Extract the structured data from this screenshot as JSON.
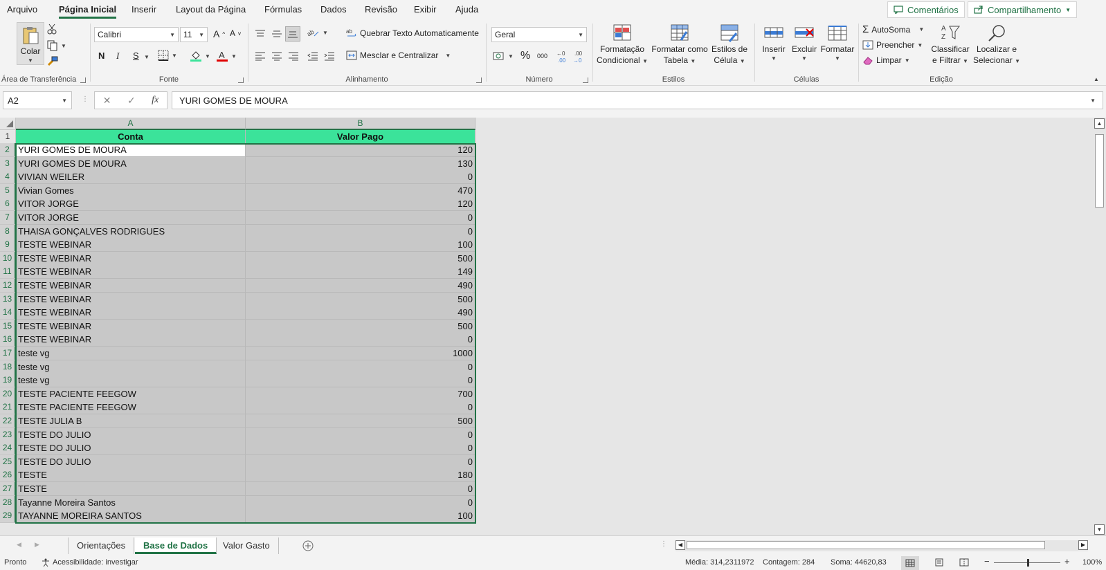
{
  "menu": {
    "tabs": [
      "Arquivo",
      "Página Inicial",
      "Inserir",
      "Layout da Página",
      "Fórmulas",
      "Dados",
      "Revisão",
      "Exibir",
      "Ajuda"
    ],
    "active_tab": "Página Inicial",
    "comments_label": "Comentários",
    "share_label": "Compartilhamento"
  },
  "ribbon": {
    "clipboard": {
      "label": "Área de Transferência",
      "paste_label": "Colar"
    },
    "font": {
      "label": "Fonte",
      "font_name": "Calibri",
      "font_size": "11",
      "bold": "N",
      "italic": "I",
      "underline": "S"
    },
    "alignment": {
      "label": "Alinhamento",
      "wrap_label": "Quebrar Texto Automaticamente",
      "merge_label": "Mesclar e Centralizar"
    },
    "number": {
      "label": "Número",
      "format": "Geral",
      "percent": "%",
      "thousands": "000"
    },
    "styles": {
      "label": "Estilos",
      "cond_format_line1": "Formatação",
      "cond_format_line2": "Condicional",
      "table_line1": "Formatar como",
      "table_line2": "Tabela",
      "cell_styles_line1": "Estilos de",
      "cell_styles_line2": "Célula"
    },
    "cells": {
      "label": "Células",
      "insert_label": "Inserir",
      "delete_label": "Excluir",
      "format_label": "Formatar"
    },
    "editing": {
      "label": "Edição",
      "autosum_label": "AutoSoma",
      "fill_label": "Preencher",
      "clear_label": "Limpar",
      "sort_line1": "Classificar",
      "sort_line2": "e Filtrar",
      "find_line1": "Localizar e",
      "find_line2": "Selecionar"
    }
  },
  "formula_bar": {
    "name_box": "A2",
    "fx_symbol": "fx",
    "value": "YURI GOMES DE MOURA"
  },
  "sheet": {
    "columns": [
      "A",
      "B"
    ],
    "header_row": {
      "row": "1",
      "a": "Conta",
      "b": "Valor Pago"
    },
    "rows": [
      {
        "row": "2",
        "a": "YURI GOMES DE MOURA",
        "b": "120"
      },
      {
        "row": "3",
        "a": "YURI GOMES DE MOURA",
        "b": "130"
      },
      {
        "row": "4",
        "a": "VIVIAN WEILER",
        "b": "0"
      },
      {
        "row": "5",
        "a": "Vivian Gomes",
        "b": "470"
      },
      {
        "row": "6",
        "a": "VITOR JORGE",
        "b": "120"
      },
      {
        "row": "7",
        "a": "VITOR JORGE",
        "b": "0"
      },
      {
        "row": "8",
        "a": "THAISA GONÇALVES RODRIGUES",
        "b": "0"
      },
      {
        "row": "9",
        "a": "TESTE WEBINAR",
        "b": "100"
      },
      {
        "row": "10",
        "a": "TESTE WEBINAR",
        "b": "500"
      },
      {
        "row": "11",
        "a": "TESTE WEBINAR",
        "b": "149"
      },
      {
        "row": "12",
        "a": "TESTE WEBINAR",
        "b": "490"
      },
      {
        "row": "13",
        "a": "TESTE WEBINAR",
        "b": "500"
      },
      {
        "row": "14",
        "a": "TESTE WEBINAR",
        "b": "490"
      },
      {
        "row": "15",
        "a": "TESTE WEBINAR",
        "b": "500"
      },
      {
        "row": "16",
        "a": "TESTE WEBINAR",
        "b": "0"
      },
      {
        "row": "17",
        "a": "teste vg",
        "b": "1000"
      },
      {
        "row": "18",
        "a": "teste vg",
        "b": "0"
      },
      {
        "row": "19",
        "a": "teste vg",
        "b": "0"
      },
      {
        "row": "20",
        "a": "TESTE PACIENTE FEEGOW",
        "b": "700"
      },
      {
        "row": "21",
        "a": "TESTE PACIENTE FEEGOW",
        "b": "0"
      },
      {
        "row": "22",
        "a": "TESTE JULIA B",
        "b": "500"
      },
      {
        "row": "23",
        "a": "TESTE DO JULIO",
        "b": "0"
      },
      {
        "row": "24",
        "a": "TESTE DO JULIO",
        "b": "0"
      },
      {
        "row": "25",
        "a": "TESTE DO JULIO",
        "b": "0"
      },
      {
        "row": "26",
        "a": "TESTE",
        "b": "180"
      },
      {
        "row": "27",
        "a": "TESTE",
        "b": "0"
      },
      {
        "row": "28",
        "a": "Tayanne Moreira Santos",
        "b": "0"
      },
      {
        "row": "29",
        "a": "TAYANNE MOREIRA SANTOS",
        "b": "100"
      }
    ]
  },
  "sheet_tabs": [
    "Orientações",
    "Base de Dados",
    "Valor Gasto"
  ],
  "active_sheet": "Base de Dados",
  "status": {
    "ready": "Pronto",
    "accessibility": "Acessibilidade: investigar",
    "average": "Média: 314,2311972",
    "count": "Contagem: 284",
    "sum": "Soma: 44620,83",
    "zoom": "100%"
  },
  "colors": {
    "accent": "#217346",
    "header_fill": "#3be39a",
    "selection_fill": "#c8c8c8"
  }
}
